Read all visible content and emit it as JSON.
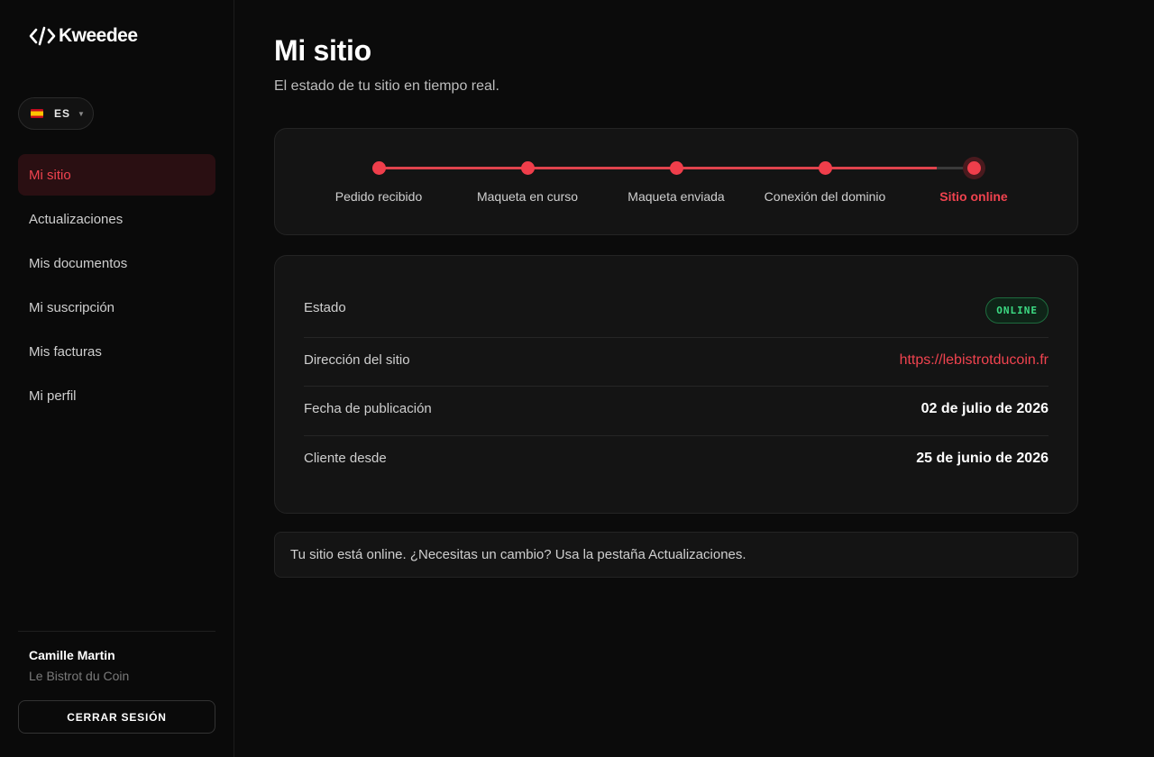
{
  "brand": {
    "name": "Kweedee"
  },
  "language": {
    "code": "ES",
    "flag_icon": "spain-flag-icon"
  },
  "nav": {
    "items": [
      {
        "label": "Mi sitio",
        "active": true
      },
      {
        "label": "Actualizaciones",
        "active": false
      },
      {
        "label": "Mis documentos",
        "active": false
      },
      {
        "label": "Mi suscripción",
        "active": false
      },
      {
        "label": "Mis facturas",
        "active": false
      },
      {
        "label": "Mi perfil",
        "active": false
      }
    ]
  },
  "user": {
    "name": "Camille Martin",
    "company": "Le Bistrot du Coin"
  },
  "logout": {
    "label": "CERRAR SESIÓN"
  },
  "page": {
    "title": "Mi sitio",
    "subtitle": "El estado de tu sitio en tiempo real."
  },
  "progress": {
    "steps": [
      {
        "label": "Pedido recibido"
      },
      {
        "label": "Maqueta en curso"
      },
      {
        "label": "Maqueta enviada"
      },
      {
        "label": "Conexión del dominio"
      },
      {
        "label": "Sitio online"
      }
    ],
    "current_step": 5
  },
  "details": {
    "status": {
      "label": "Estado",
      "value": "ONLINE"
    },
    "address": {
      "label": "Dirección del sitio",
      "value": "https://lebistrotducoin.fr"
    },
    "published": {
      "label": "Fecha de publicación",
      "value": "02 de julio de 2026"
    },
    "client_since": {
      "label": "Cliente desde",
      "value": "25 de junio de 2026"
    }
  },
  "note": {
    "text": "Tu sitio está online. ¿Necesitas un cambio? Usa la pestaña Actualizaciones."
  },
  "colors": {
    "accent": "#ef3e4b",
    "online": "#3ddc84",
    "background": "#0b0b0b"
  }
}
